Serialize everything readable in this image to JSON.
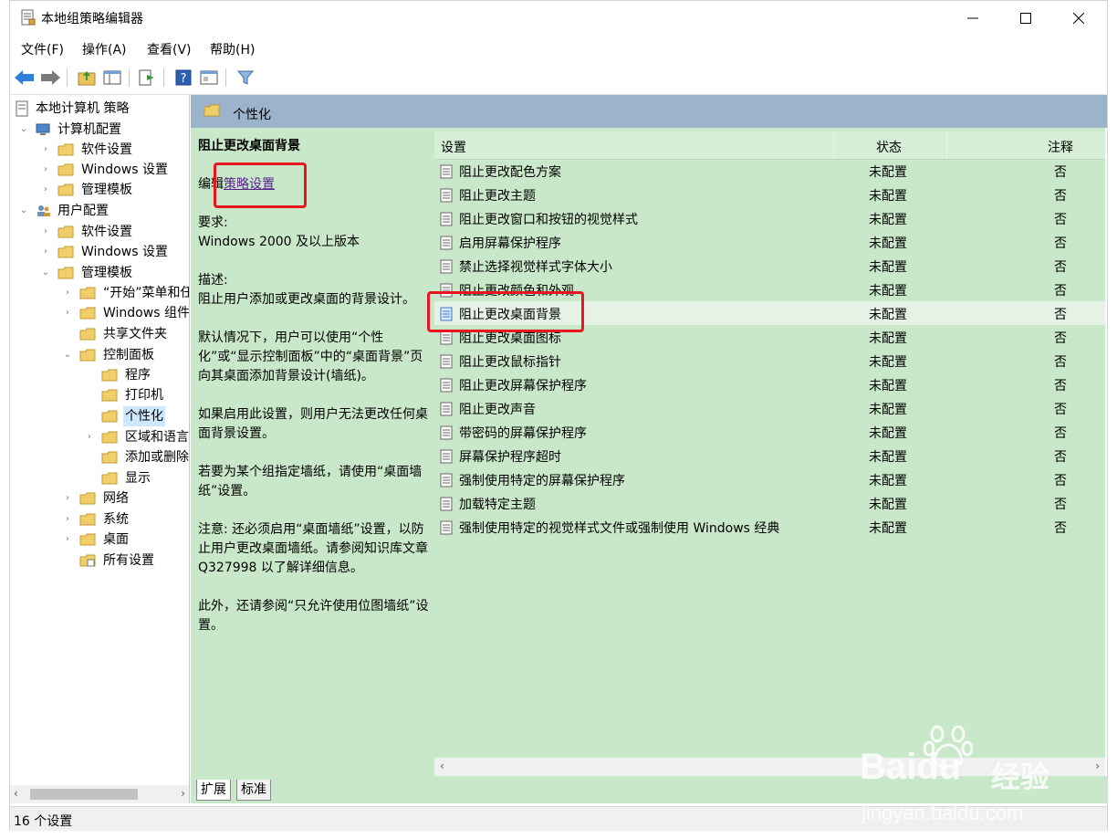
{
  "window": {
    "title": "本地组策略编辑器"
  },
  "menu": [
    "文件(F)",
    "操作(A)",
    "查看(V)",
    "帮助(H)"
  ],
  "tree": {
    "root": "本地计算机 策略",
    "computer_config": "计算机配置",
    "software_settings": "软件设置",
    "windows_settings": "Windows 设置",
    "admin_templates": "管理模板",
    "user_config": "用户配置",
    "u_software_settings": "软件设置",
    "u_windows_settings": "Windows 设置",
    "u_admin_templates": "管理模板",
    "start_menu": "“开始”菜单和任",
    "windows_components": "Windows 组件",
    "shared_folders": "共享文件夹",
    "control_panel": "控制面板",
    "programs": "程序",
    "printers": "打印机",
    "personalization": "个性化",
    "region_language": "区域和语言",
    "add_remove": "添加或删除",
    "display": "显示",
    "network": "网络",
    "system": "系统",
    "desktop": "桌面",
    "all_settings": "所有设置"
  },
  "header": {
    "title": "个性化"
  },
  "description": {
    "title": "阻止更改桌面背景",
    "edit_prefix": "编辑",
    "edit_link": "策略设置",
    "requirements_label": "要求:",
    "requirements_value": "Windows 2000 及以上版本",
    "description_label": "描述:",
    "description_text": "阻止用户添加或更改桌面的背景设计。",
    "para1": "默认情况下，用户可以使用“个性化”或“显示控制面板”中的“桌面背景”页向其桌面添加背景设计(墙纸)。",
    "para2": "如果启用此设置，则用户无法更改任何桌面背景设置。",
    "para3": "若要为某个组指定墙纸，请使用“桌面墙纸”设置。",
    "para4": "注意: 还必须启用“桌面墙纸”设置，以防止用户更改桌面墙纸。请参阅知识库文章 Q327998 以了解详细信息。",
    "para5": "此外，还请参阅“只允许使用位图墙纸”设置。"
  },
  "list": {
    "columns": {
      "setting": "设置",
      "state": "状态",
      "note": "注释"
    },
    "rows": [
      {
        "name": "阻止更改配色方案",
        "state": "未配置",
        "note": "否"
      },
      {
        "name": "阻止更改主题",
        "state": "未配置",
        "note": "否"
      },
      {
        "name": "阻止更改窗口和按钮的视觉样式",
        "state": "未配置",
        "note": "否"
      },
      {
        "name": "启用屏幕保护程序",
        "state": "未配置",
        "note": "否"
      },
      {
        "name": "禁止选择视觉样式字体大小",
        "state": "未配置",
        "note": "否"
      },
      {
        "name": "阻止更改颜色和外观",
        "state": "未配置",
        "note": "否"
      },
      {
        "name": "阻止更改桌面背景",
        "state": "未配置",
        "note": "否"
      },
      {
        "name": "阻止更改桌面图标",
        "state": "未配置",
        "note": "否"
      },
      {
        "name": "阻止更改鼠标指针",
        "state": "未配置",
        "note": "否"
      },
      {
        "name": "阻止更改屏幕保护程序",
        "state": "未配置",
        "note": "否"
      },
      {
        "name": "阻止更改声音",
        "state": "未配置",
        "note": "否"
      },
      {
        "name": "带密码的屏幕保护程序",
        "state": "未配置",
        "note": "否"
      },
      {
        "name": "屏幕保护程序超时",
        "state": "未配置",
        "note": "否"
      },
      {
        "name": "强制使用特定的屏幕保护程序",
        "state": "未配置",
        "note": "否"
      },
      {
        "name": "加载特定主题",
        "state": "未配置",
        "note": "否"
      },
      {
        "name": "强制使用特定的视觉样式文件或强制使用 Windows 经典",
        "state": "未配置",
        "note": "否"
      }
    ]
  },
  "tabs": [
    "扩展",
    "标准"
  ],
  "status": "16 个设置",
  "watermark": {
    "brand": "Baidu",
    "brand_cn": "经验",
    "url": "jingyan.baidu.com"
  },
  "colors": {
    "content_bg": "#c9e8c9",
    "header_band": "#9bb4cc",
    "highlight_box": "#e8171f",
    "selection": "#cce8ff"
  }
}
